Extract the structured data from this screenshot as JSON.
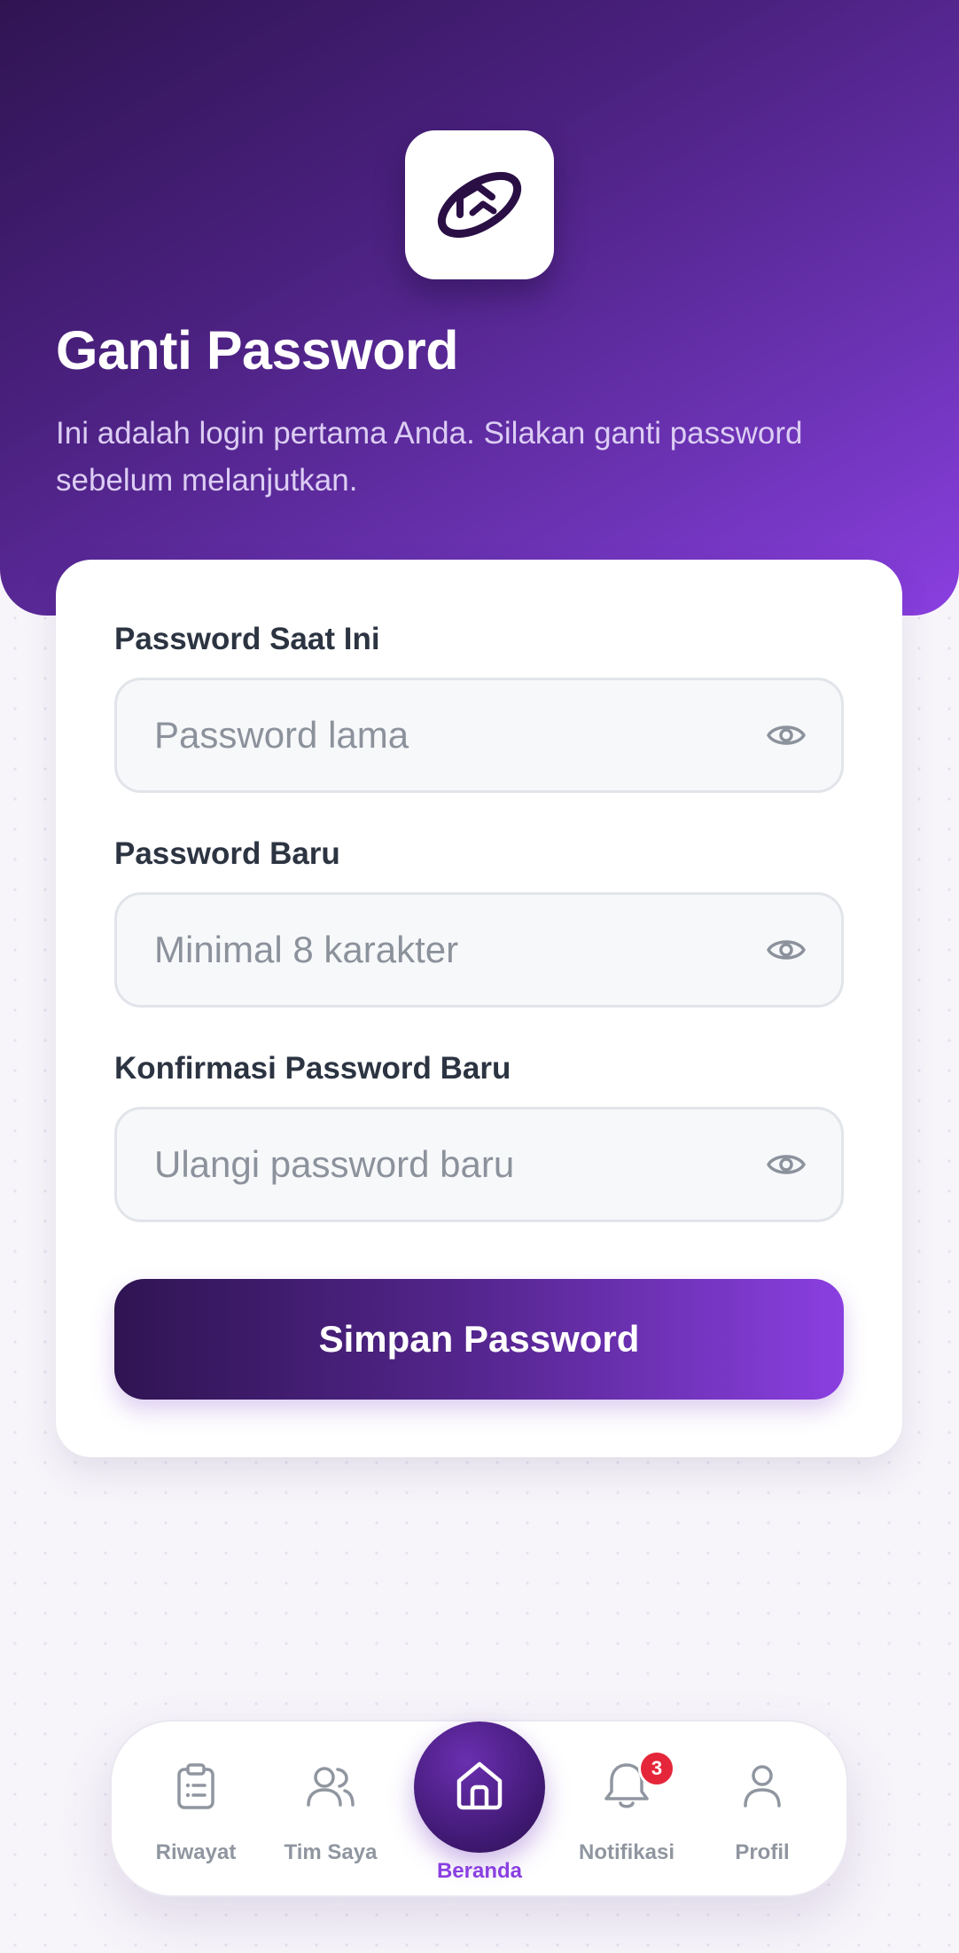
{
  "header": {
    "logo_icon": "app-logo-icon",
    "title": "Ganti Password",
    "subtitle": "Ini adalah login pertama Anda. Silakan ganti password sebelum melanjutkan."
  },
  "form": {
    "current_password": {
      "label": "Password Saat Ini",
      "placeholder": "Password lama",
      "value": "",
      "toggle_icon": "eye-icon"
    },
    "new_password": {
      "label": "Password Baru",
      "placeholder": "Minimal 8 karakter",
      "value": "",
      "toggle_icon": "eye-icon"
    },
    "confirm_password": {
      "label": "Konfirmasi Password Baru",
      "placeholder": "Ulangi password baru",
      "value": "",
      "toggle_icon": "eye-icon"
    },
    "submit_label": "Simpan Password"
  },
  "bottom_nav": {
    "items": [
      {
        "label": "Riwayat",
        "icon": "clipboard-list-icon",
        "active": false
      },
      {
        "label": "Tim Saya",
        "icon": "users-icon",
        "active": false
      },
      {
        "label": "Beranda",
        "icon": "home-icon",
        "active": true
      },
      {
        "label": "Notifikasi",
        "icon": "bell-icon",
        "active": false,
        "badge": "3"
      },
      {
        "label": "Profil",
        "icon": "user-icon",
        "active": false
      }
    ]
  },
  "colors": {
    "primary_dark": "#2f1452",
    "primary": "#8a3fe0",
    "badge": "#e5263a"
  }
}
